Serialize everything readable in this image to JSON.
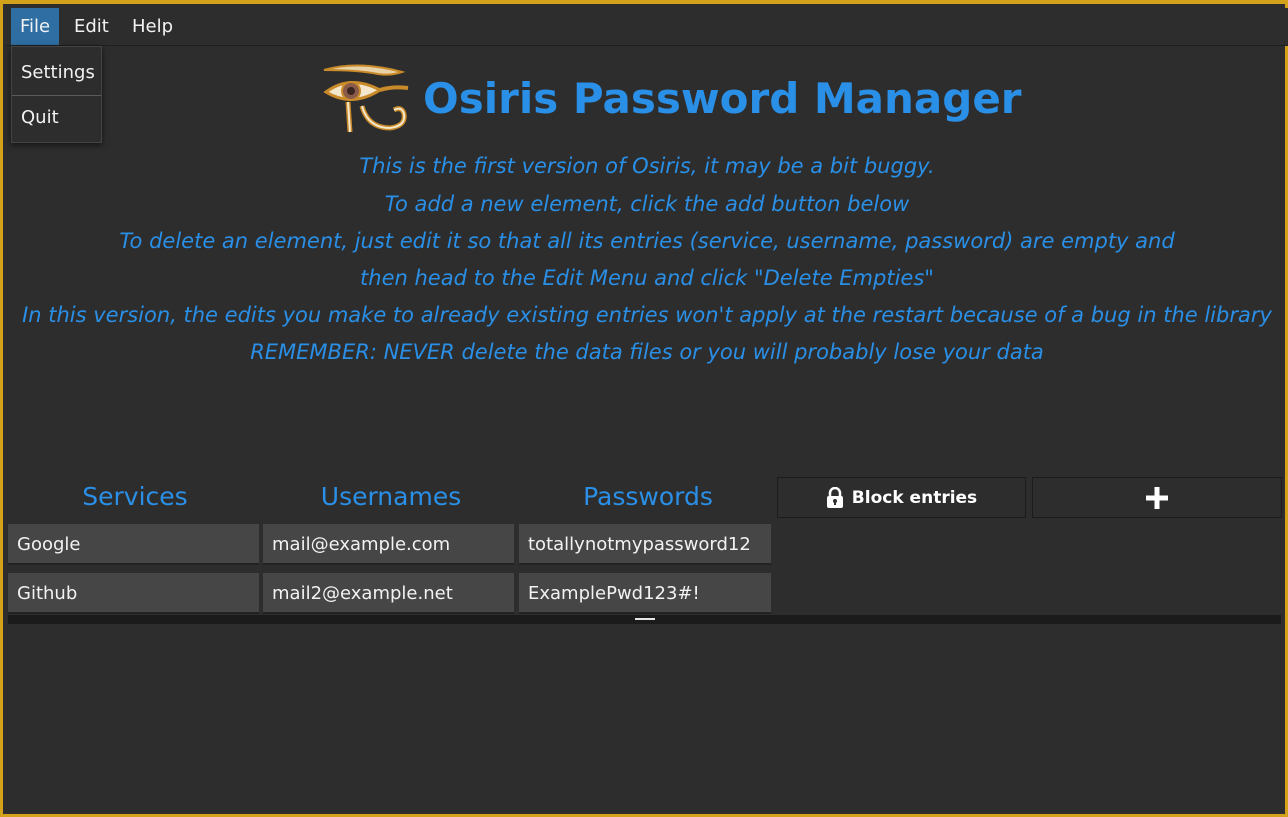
{
  "menubar": {
    "file": "File",
    "edit": "Edit",
    "help": "Help"
  },
  "file_menu": {
    "settings": "Settings",
    "quit": "Quit"
  },
  "app": {
    "title": "Osiris Password Manager",
    "logo_icon": "eye-of-horus-icon"
  },
  "info_lines": [
    "This is the first version of Osiris, it may be a bit buggy.",
    "To add a new element, click the add button below",
    "To delete an element, just edit it so that all its entries (service, username, password) are empty and",
    "then head to the Edit Menu and click \"Delete Empties\"",
    "In this version, the edits you make to already existing entries won't apply at the restart because of a bug in the library",
    "REMEMBER: NEVER delete the data files or you will probably lose your data"
  ],
  "table": {
    "headers": {
      "services": "Services",
      "usernames": "Usernames",
      "passwords": "Passwords"
    },
    "rows": [
      {
        "service": "Google",
        "username": "mail@example.com",
        "password": "totallynotmypassword12"
      },
      {
        "service": "Github",
        "username": "mail2@example.net",
        "password": "ExamplePwd123#!"
      }
    ]
  },
  "buttons": {
    "block_entries": "Block entries",
    "block_icon": "lock-icon",
    "add_icon": "plus-icon"
  },
  "colors": {
    "accent": "#2a8fe6",
    "background": "#2d2d2d",
    "cell": "#464646",
    "frame": "#d4a21a",
    "menu_active": "#2f6ea3"
  }
}
